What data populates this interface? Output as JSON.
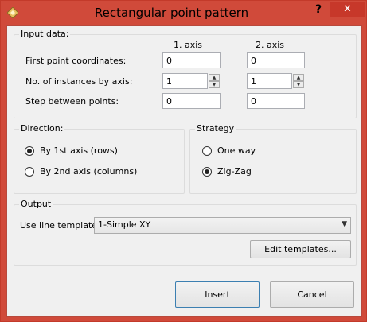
{
  "window": {
    "title": "Rectangular point pattern",
    "help": "?",
    "close": "✕"
  },
  "input_data": {
    "label": "Input data:",
    "col1": "1. axis",
    "col2": "2. axis",
    "rows": [
      {
        "label": "First point coordinates:",
        "v1": "0",
        "v2": "0"
      },
      {
        "label": "No. of instances by axis:",
        "v1": "1",
        "v2": "1"
      },
      {
        "label": "Step between points:",
        "v1": "0",
        "v2": "0"
      }
    ]
  },
  "direction": {
    "label": "Direction:",
    "options": [
      {
        "label": "By 1st axis (rows)",
        "selected": true
      },
      {
        "label": "By 2nd axis (columns)",
        "selected": false
      }
    ]
  },
  "strategy": {
    "label": "Strategy",
    "options": [
      {
        "label": "One way",
        "selected": false
      },
      {
        "label": "Zig-Zag",
        "selected": true
      }
    ]
  },
  "output": {
    "label": "Output",
    "template_label": "Use line template:",
    "template_value": "1-Simple XY",
    "edit_button": "Edit templates..."
  },
  "buttons": {
    "insert": "Insert",
    "cancel": "Cancel"
  },
  "colors": {
    "titlebar": "#d04a3a",
    "accent_border": "#3c7fb1"
  }
}
